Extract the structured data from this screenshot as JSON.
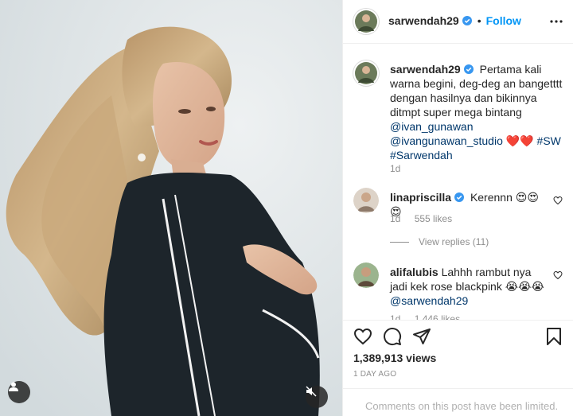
{
  "post": {
    "username": "sarwendah29",
    "follow_label": "Follow",
    "separator": "•"
  },
  "caption": {
    "username": "sarwendah29",
    "text": "Pertama kali warna begini, deg-deg an bangetttt dengan hasilnya dan bikinnya ditmpt super mega bintang",
    "mention1": "@ivan_gunawan",
    "mention2": "@ivangunawan_studio",
    "hearts": "❤️❤️",
    "tag1": "#SW",
    "tag2": "#Sarwendah",
    "time": "1d"
  },
  "comments": [
    {
      "username": "linapriscilla",
      "text": "Kerennn 😍😍😍",
      "time": "1d",
      "likes": "555 likes",
      "view_replies": "View replies (11)"
    },
    {
      "username": "alifalubis",
      "text": "Lahhh rambut nya jadi kek rose blackpink 😭😭😭",
      "mention": "@sarwendah29",
      "time": "1d",
      "likes": "1,446 likes"
    }
  ],
  "stats": {
    "views": "1,389,913 views",
    "date": "1 DAY AGO"
  },
  "footer": {
    "limited_text": "Comments on this post have been limited."
  },
  "icons": {
    "tag": "user-tag-icon",
    "mute": "speaker-muted-icon",
    "like": "heart-icon",
    "comment": "comment-bubble-icon",
    "share": "paper-plane-icon",
    "save": "bookmark-icon",
    "more": "more-horizontal-icon",
    "verified": "verified-badge-icon"
  },
  "colors": {
    "link": "#00376b",
    "follow": "#0095f6",
    "verified": "#3897f0",
    "meta": "#8e8e8e"
  }
}
